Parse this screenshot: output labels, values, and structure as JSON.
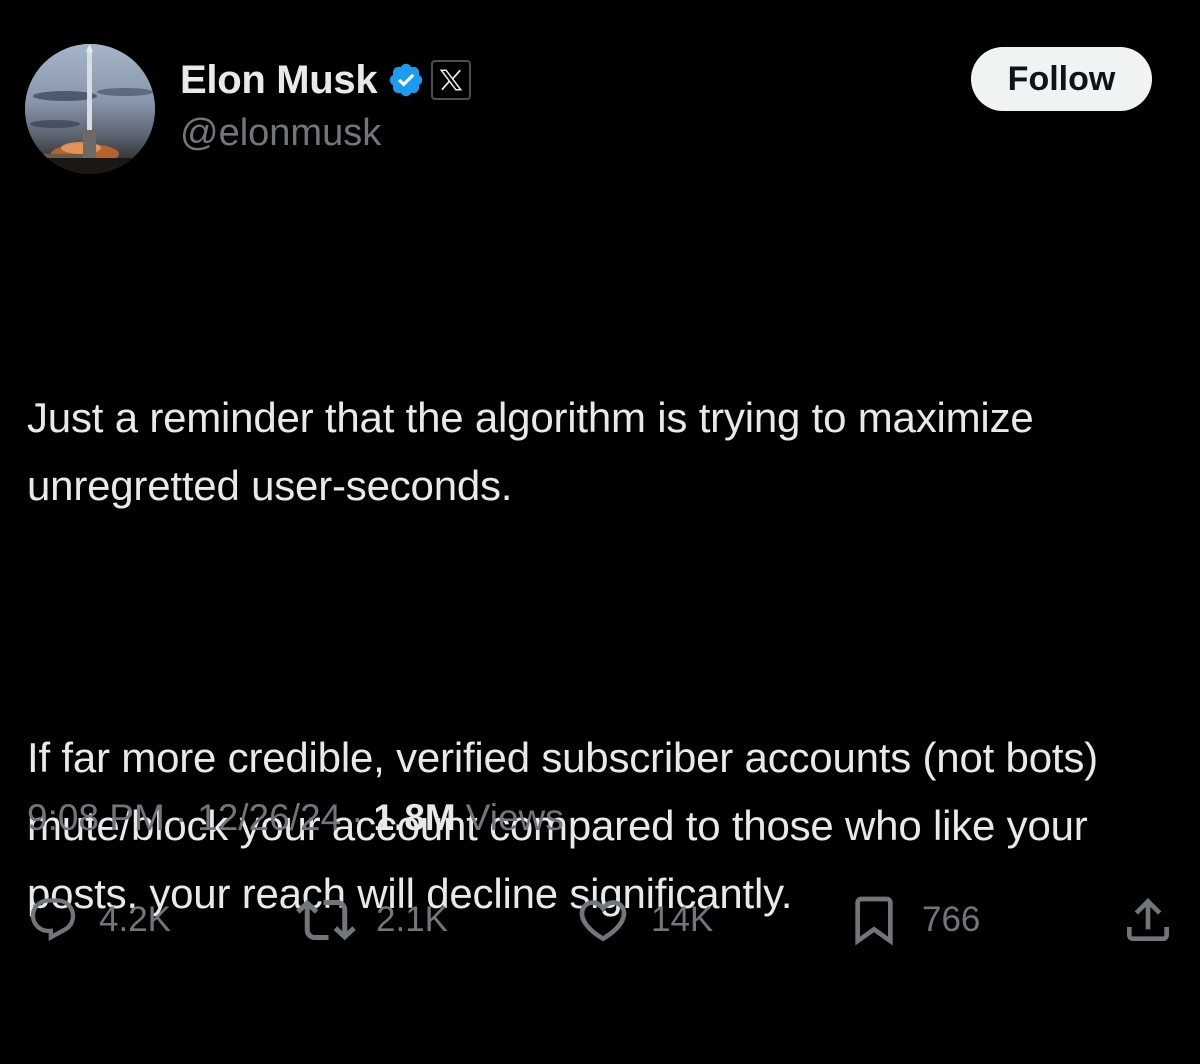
{
  "author": {
    "display_name": "Elon Musk",
    "handle": "@elonmusk",
    "verified_icon": "verified-badge-icon",
    "affiliate_icon": "x-logo-icon"
  },
  "follow_button": {
    "label": "Follow"
  },
  "tweet": {
    "paragraph_1": "Just a reminder that the algorithm is trying to maximize unregretted user-seconds.",
    "paragraph_2": "If far more credible, verified subscriber accounts (not bots) mute/block your account compared to those who like your posts, your reach will decline significantly."
  },
  "meta": {
    "time": "9:08 PM",
    "separator": "·",
    "date": "12/26/24",
    "views_count": "1.8M",
    "views_label": "Views"
  },
  "actions": {
    "reply": {
      "icon": "reply-icon",
      "count": "4.2K"
    },
    "repost": {
      "icon": "repost-icon",
      "count": "2.1K"
    },
    "like": {
      "icon": "heart-icon",
      "count": "14K"
    },
    "bookmark": {
      "icon": "bookmark-icon",
      "count": "766"
    },
    "share": {
      "icon": "share-icon"
    }
  },
  "colors": {
    "background": "#000000",
    "primary_text": "#e7e9ea",
    "secondary_text": "#71767b",
    "verified_blue": "#1d9bf0",
    "follow_button_bg": "#eff3f4"
  }
}
